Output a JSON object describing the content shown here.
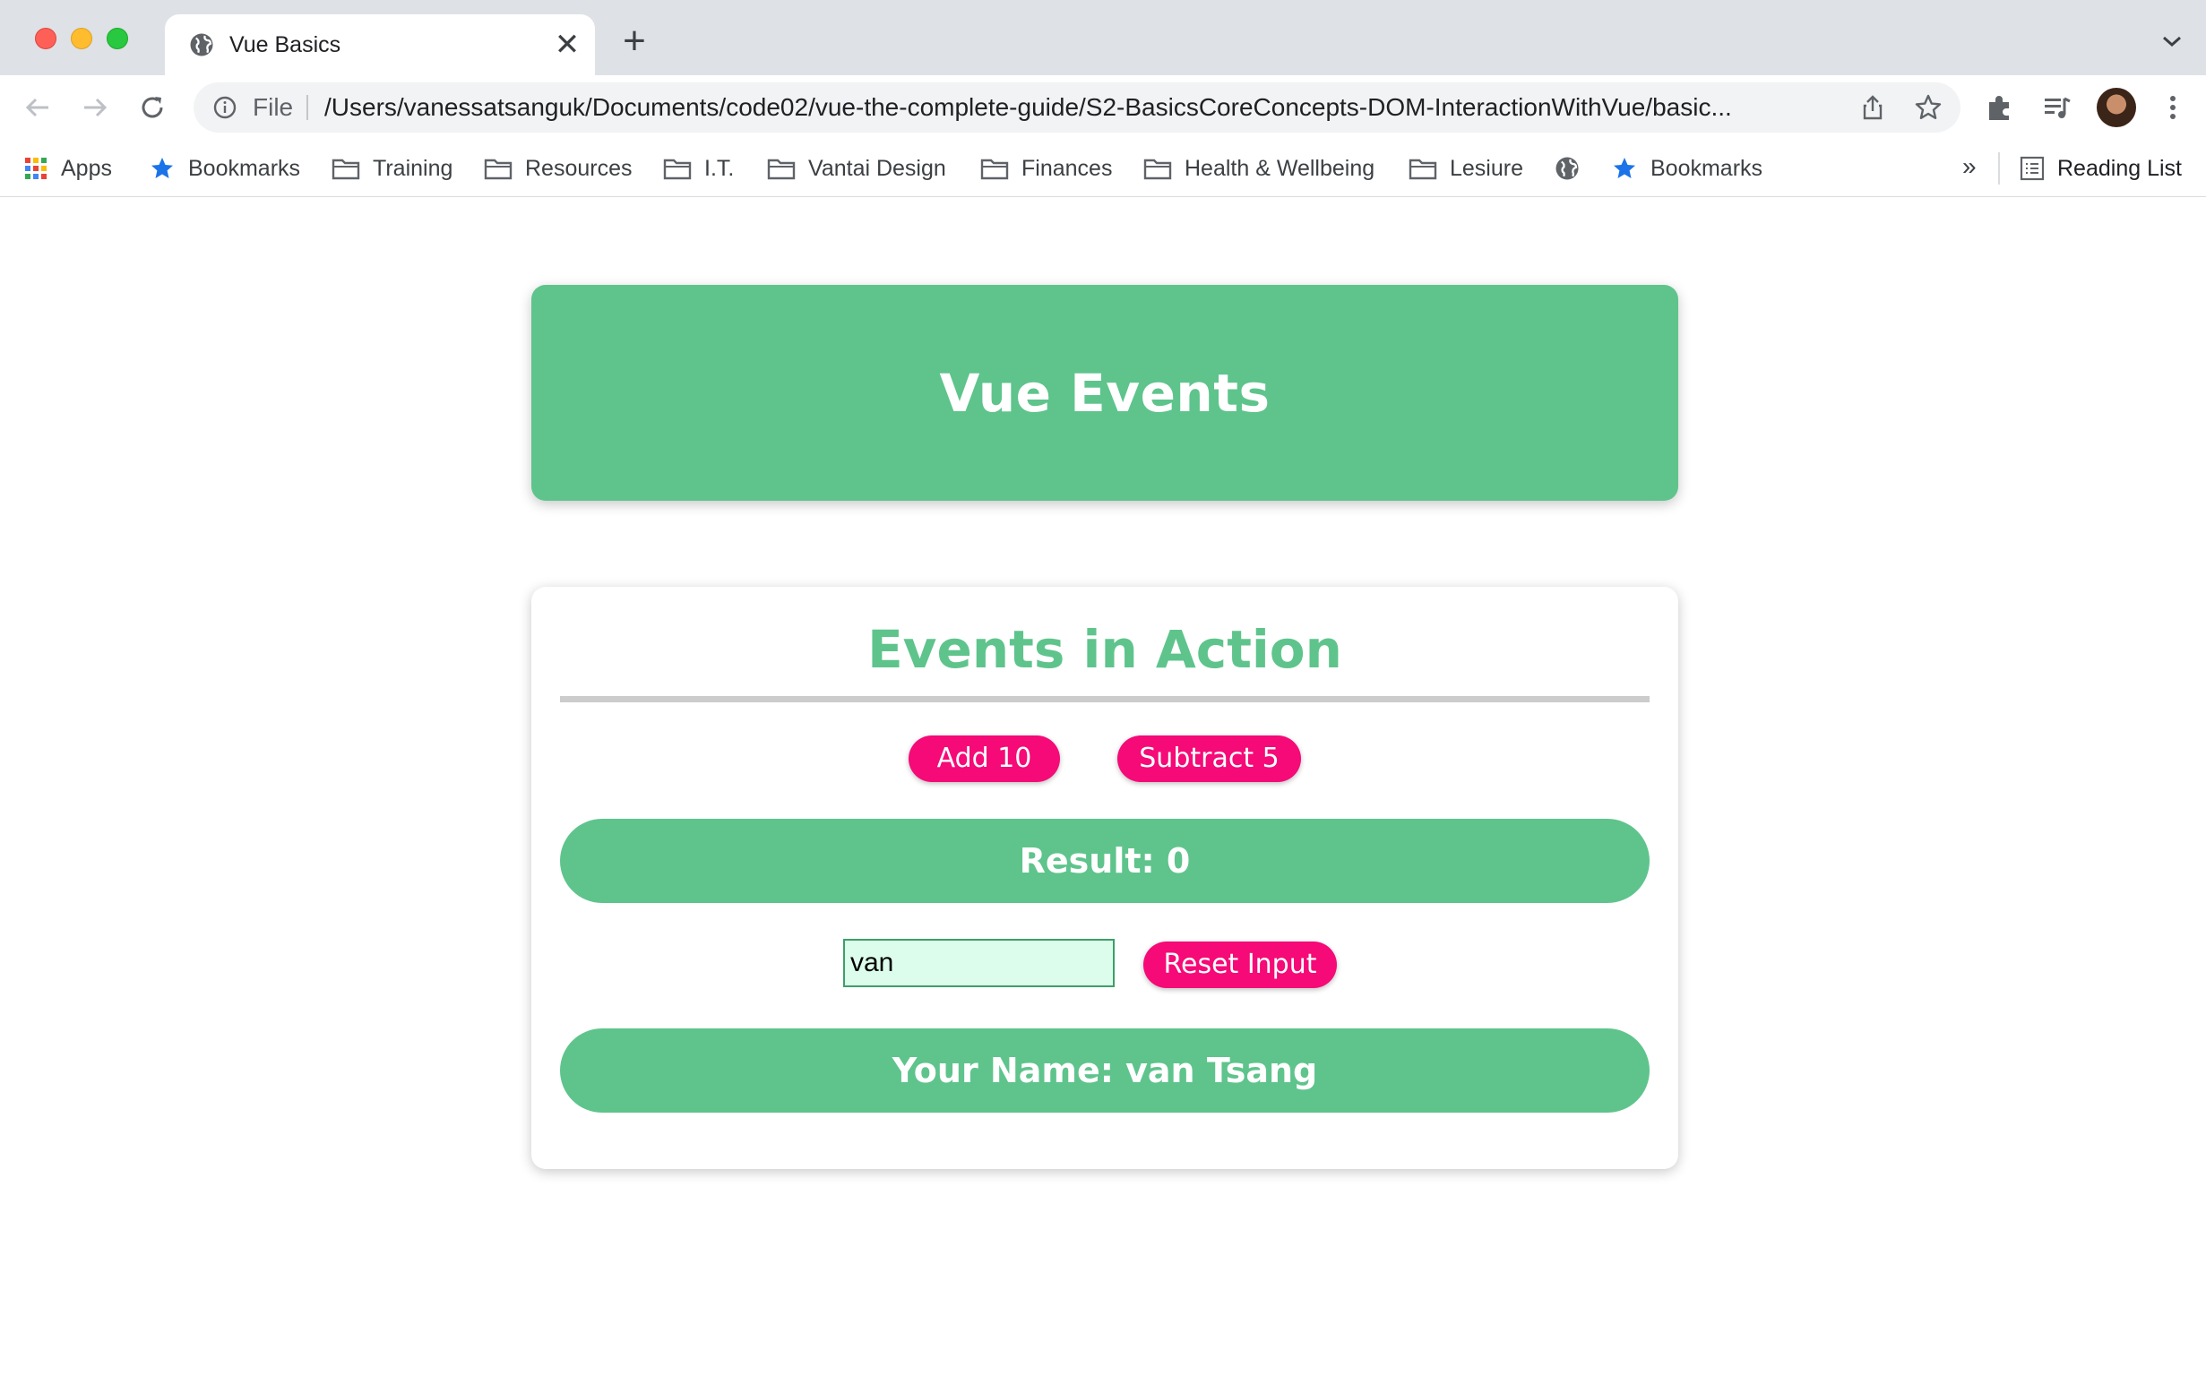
{
  "browser": {
    "tab": {
      "title": "Vue Basics",
      "close": "✕"
    },
    "new_tab": "+",
    "omnibox": {
      "scheme": "File",
      "url": "/Users/vanessatsanguk/Documents/code02/vue-the-complete-guide/S2-BasicsCoreConcepts-DOM-InteractionWithVue/basic..."
    },
    "bookmarks": [
      {
        "label": "Apps",
        "icon": "apps-grid-icon"
      },
      {
        "label": "Bookmarks",
        "icon": "star-icon"
      },
      {
        "label": "Training",
        "icon": "folder-icon"
      },
      {
        "label": "Resources",
        "icon": "folder-icon"
      },
      {
        "label": "I.T.",
        "icon": "folder-icon"
      },
      {
        "label": "Vantai Design",
        "icon": "folder-icon"
      },
      {
        "label": "Finances",
        "icon": "folder-icon"
      },
      {
        "label": "Health & Wellbeing",
        "icon": "folder-icon"
      },
      {
        "label": "Lesiure",
        "icon": "folder-icon"
      },
      {
        "label": "",
        "icon": "globe-icon"
      },
      {
        "label": "Bookmarks",
        "icon": "star-icon"
      }
    ],
    "overflow": "»",
    "reading_list": "Reading List"
  },
  "page": {
    "header_title": "Vue Events",
    "card_title": "Events in Action",
    "add_button": "Add 10",
    "subtract_button": "Subtract 5",
    "result_text": "Result: 0",
    "name_input_value": "van",
    "reset_button": "Reset Input",
    "name_text": "Your Name: van Tsang"
  },
  "colors": {
    "accent_green": "#5ec48c",
    "button_pink": "#f50a77",
    "input_bg": "#dcfdec"
  }
}
